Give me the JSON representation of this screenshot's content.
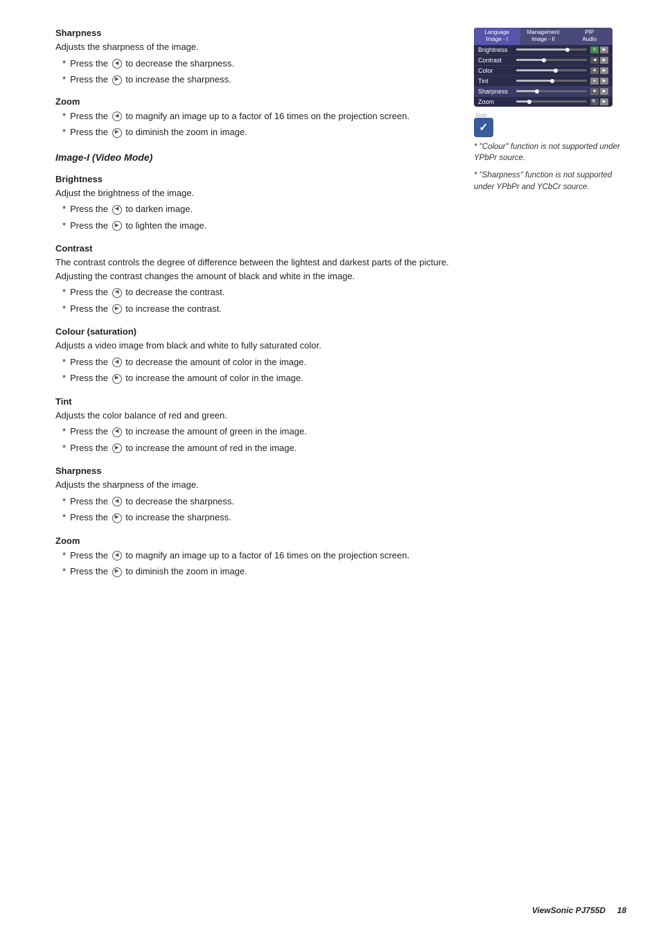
{
  "page": {
    "footer": {
      "brand": "ViewSonic PJ755D",
      "page_number": "18"
    }
  },
  "osd": {
    "tabs": [
      {
        "label": "Language\nImage - I",
        "active": true
      },
      {
        "label": "Management\nImage - II",
        "active": false
      },
      {
        "label": "PIP\nAudio",
        "active": false
      }
    ],
    "rows": [
      {
        "label": "Brightness",
        "fill_pct": 75,
        "dot_pct": 75,
        "highlighted": false
      },
      {
        "label": "Contrast",
        "fill_pct": 40,
        "dot_pct": 40,
        "highlighted": false
      },
      {
        "label": "Color",
        "fill_pct": 55,
        "dot_pct": 55,
        "highlighted": false
      },
      {
        "label": "Tint",
        "fill_pct": 50,
        "dot_pct": 50,
        "highlighted": false
      },
      {
        "label": "Sharpness",
        "fill_pct": 30,
        "dot_pct": 30,
        "highlighted": true
      },
      {
        "label": "Zoom",
        "fill_pct": 20,
        "dot_pct": 20,
        "highlighted": false
      }
    ]
  },
  "notes": [
    "\"Colour\" function is not supported under YPbPr source.",
    "\"Sharpness\" function is not supported under YPbPr and YCbCr source."
  ],
  "sections_top": [
    {
      "id": "sharpness-top",
      "title": "Sharpness",
      "italic": false,
      "intro": "Adjusts the sharpness of the image.",
      "bullets": [
        {
          "icon": "left",
          "text": "Press the  to decrease the sharpness."
        },
        {
          "icon": "right",
          "text": "Press the  to increase the sharpness."
        }
      ]
    },
    {
      "id": "zoom-top",
      "title": "Zoom",
      "italic": false,
      "intro": null,
      "bullets": [
        {
          "icon": "left",
          "text": "Press the  to magnify an image up to a factor of 16 times on the projection screen."
        },
        {
          "icon": "right",
          "text": "Press the  to diminish the zoom in image."
        }
      ]
    }
  ],
  "video_mode_section": {
    "title": "Image-I  (Video Mode)",
    "italic": true,
    "subsections": [
      {
        "id": "brightness",
        "title": "Brightness",
        "intro": "Adjust the brightness of the image.",
        "bullets": [
          {
            "icon": "left",
            "text": "Press the  to darken image."
          },
          {
            "icon": "right",
            "text": "Press the  to lighten the image."
          }
        ]
      },
      {
        "id": "contrast",
        "title": "Contrast",
        "intro": "The contrast controls the degree of difference between the lightest and darkest parts of the picture. Adjusting the contrast changes the amount of black and white in the image.",
        "bullets": [
          {
            "icon": "left",
            "text": "Press the  to decrease the contrast."
          },
          {
            "icon": "right",
            "text": "Press the  to increase the contrast."
          }
        ]
      },
      {
        "id": "colour",
        "title": "Colour (saturation)",
        "intro": "Adjusts a video image from black and white to  fully saturated color.",
        "bullets": [
          {
            "icon": "left",
            "text": "Press the  to decrease the amount of color in the image."
          },
          {
            "icon": "right",
            "text": "Press the  to increase the amount of color in the image."
          }
        ]
      },
      {
        "id": "tint",
        "title": "Tint",
        "intro": "Adjusts the color balance of red and green.",
        "bullets": [
          {
            "icon": "left",
            "text": "Press the  to increase the amount of green in the image."
          },
          {
            "icon": "right",
            "text": "Press the  to increase the amount of red  in the image."
          }
        ]
      },
      {
        "id": "sharpness-bottom",
        "title": "Sharpness",
        "intro": "Adjusts the sharpness of the image.",
        "bullets": [
          {
            "icon": "left",
            "text": "Press the  to decrease the sharpness."
          },
          {
            "icon": "right",
            "text": "Press the  to increase the sharpness."
          }
        ]
      },
      {
        "id": "zoom-bottom",
        "title": "Zoom",
        "intro": null,
        "bullets": [
          {
            "icon": "left",
            "text": "Press the  to magnify an image up to a factor of 16 times on the projection screen."
          },
          {
            "icon": "right",
            "text": "Press the  to diminish the zoom in image."
          }
        ]
      }
    ]
  }
}
